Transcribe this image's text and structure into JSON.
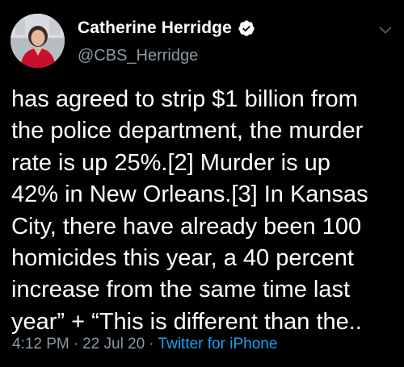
{
  "author": {
    "display_name": "Catherine Herridge",
    "handle": "@CBS_Herridge",
    "verified": true,
    "avatar_icon": "profile-photo"
  },
  "tweet": {
    "lines": [
      "has agreed to strip $1 billion from",
      "the police department, the murder",
      "rate is up 25%.[2]  Murder is up",
      "42% in New Orleans.[3] In Kansas",
      "City, there have already been 100",
      "homicides this year, a 40 percent",
      "increase from the same time last",
      "year” + “This is different than the.."
    ]
  },
  "meta": {
    "time": "4:12 PM",
    "date": "22 Jul 20",
    "separator": "·",
    "source": "Twitter for iPhone"
  },
  "colors": {
    "background": "#000000",
    "text": "#ffffff",
    "secondary": "#8b98a5",
    "link": "#1da1f2"
  },
  "icons": {
    "verified": "verified-badge-icon",
    "menu": "chevron-down-icon"
  }
}
